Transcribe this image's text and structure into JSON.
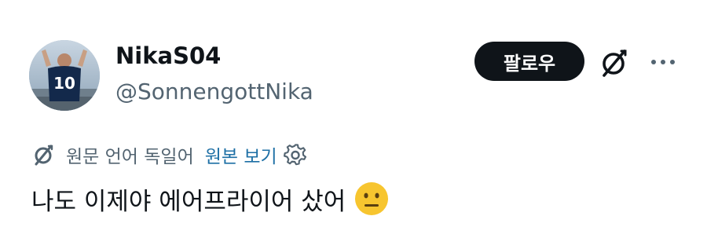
{
  "author": {
    "display_name": "NikaS04",
    "handle": "@SonnengottNika",
    "avatar_jersey_number": "10"
  },
  "actions": {
    "follow_label": "팔로우",
    "grok_icon": "grok-slash-icon",
    "more_icon": "more-horizontal-icon"
  },
  "translation": {
    "icon": "grok-slash-icon",
    "note": "원문 언어 독일어",
    "show_original_label": "원본 보기",
    "settings_icon": "gear-icon"
  },
  "tweet": {
    "text": "나도 이제야 에어프라이어 샀어",
    "emoji": "neutral-face-emoji"
  },
  "colors": {
    "text_primary": "#0f1419",
    "text_secondary": "#536471",
    "link": "#1d6fa5",
    "button_bg": "#0f1419",
    "button_text": "#ffffff",
    "emoji_yellow": "#f7c52f"
  }
}
